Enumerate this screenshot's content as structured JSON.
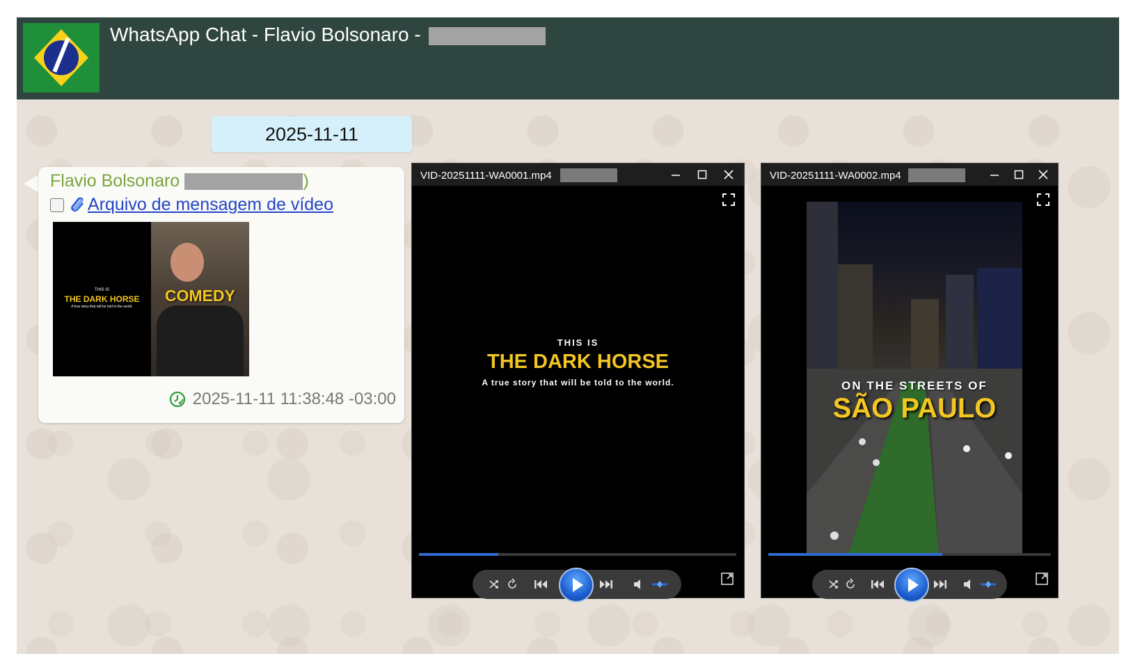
{
  "header": {
    "title": "WhatsApp Chat - Flavio Bolsonaro -"
  },
  "chat": {
    "date_separator": "2025-11-11",
    "message": {
      "sender": "Flavio Bolsonaro (",
      "sender_close": ")",
      "attachment_label": "Arquivo de mensagem de vídeo",
      "thumbnail": {
        "left_kicker": "THIS IS",
        "left_title": "THE DARK HORSE",
        "left_sub": "A true story that will be told to the world.",
        "right_caption": "COMEDY"
      },
      "timestamp": "2025-11-11 11:38:48 -03:00"
    }
  },
  "players": [
    {
      "filename": "VID-20251111-WA0001.mp4",
      "progress": 0.25,
      "video": {
        "kicker": "THIS IS",
        "title": "THE DARK HORSE",
        "subtitle": "A true story that will be told to the world."
      }
    },
    {
      "filename": "VID-20251111-WA0002.mp4",
      "progress": 0.615,
      "video": {
        "kicker": "ON THE STREETS OF",
        "title": "SÃO PAULO"
      }
    }
  ],
  "colors": {
    "header_bg": "#2f4540",
    "sender": "#7ba43f",
    "link": "#2446c6",
    "date_pill": "#d6f0fb",
    "accent_yellow": "#f3c621",
    "seek_fill": "#2f6bd1"
  },
  "icons": [
    "brazil-flag-avatar",
    "paperclip-icon",
    "clock-check-icon",
    "minimize-icon",
    "maximize-icon",
    "close-icon",
    "fullscreen-icon",
    "shuffle-icon",
    "repeat-icon",
    "previous-icon",
    "play-icon",
    "next-icon",
    "volume-icon",
    "volume-slider",
    "mini-player-icon"
  ]
}
